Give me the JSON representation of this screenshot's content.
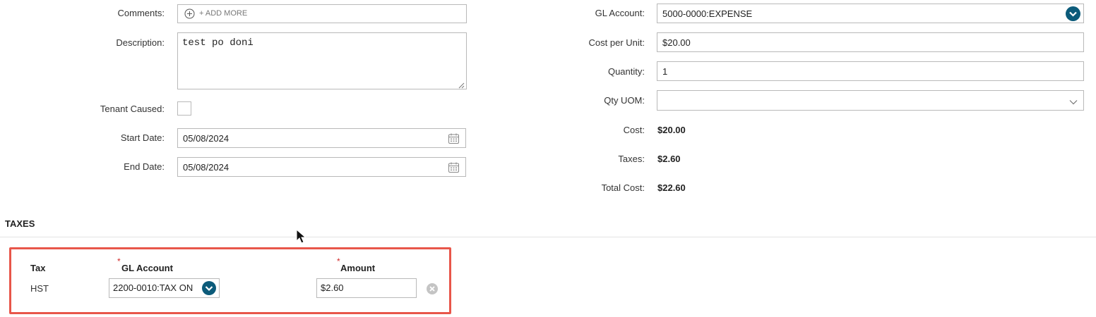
{
  "left": {
    "comments_label": "Comments:",
    "add_more": "+ ADD MORE",
    "description_label": "Description:",
    "description_value": "test po doni",
    "tenant_caused_label": "Tenant Caused:",
    "start_date_label": "Start Date:",
    "start_date_value": "05/08/2024",
    "end_date_label": "End Date:",
    "end_date_value": "05/08/2024"
  },
  "right": {
    "gl_account_label": "GL Account:",
    "gl_account_value": "5000-0000:EXPENSE",
    "cost_per_unit_label": "Cost per Unit:",
    "cost_per_unit_value": "$20.00",
    "quantity_label": "Quantity:",
    "quantity_value": "1",
    "qty_uom_label": "Qty UOM:",
    "qty_uom_value": "",
    "cost_label": "Cost:",
    "cost_value": "$20.00",
    "taxes_label": "Taxes:",
    "taxes_value": "$2.60",
    "total_cost_label": "Total Cost:",
    "total_cost_value": "$22.60"
  },
  "taxes": {
    "section_title": "TAXES",
    "col_tax": "Tax",
    "col_gl_account": "GL Account",
    "col_amount": "Amount",
    "required_mark": "*",
    "row": {
      "tax": "HST",
      "gl_account": "2200-0010:TAX ON",
      "amount": "$2.60"
    }
  },
  "colors": {
    "accent": "#0c5b7a",
    "highlight_border": "#e8564a"
  },
  "icons": [
    "plus-circle-icon",
    "calendar-icon",
    "chevron-down-icon",
    "remove-icon",
    "mouse-cursor-icon",
    "resize-handle-icon"
  ]
}
